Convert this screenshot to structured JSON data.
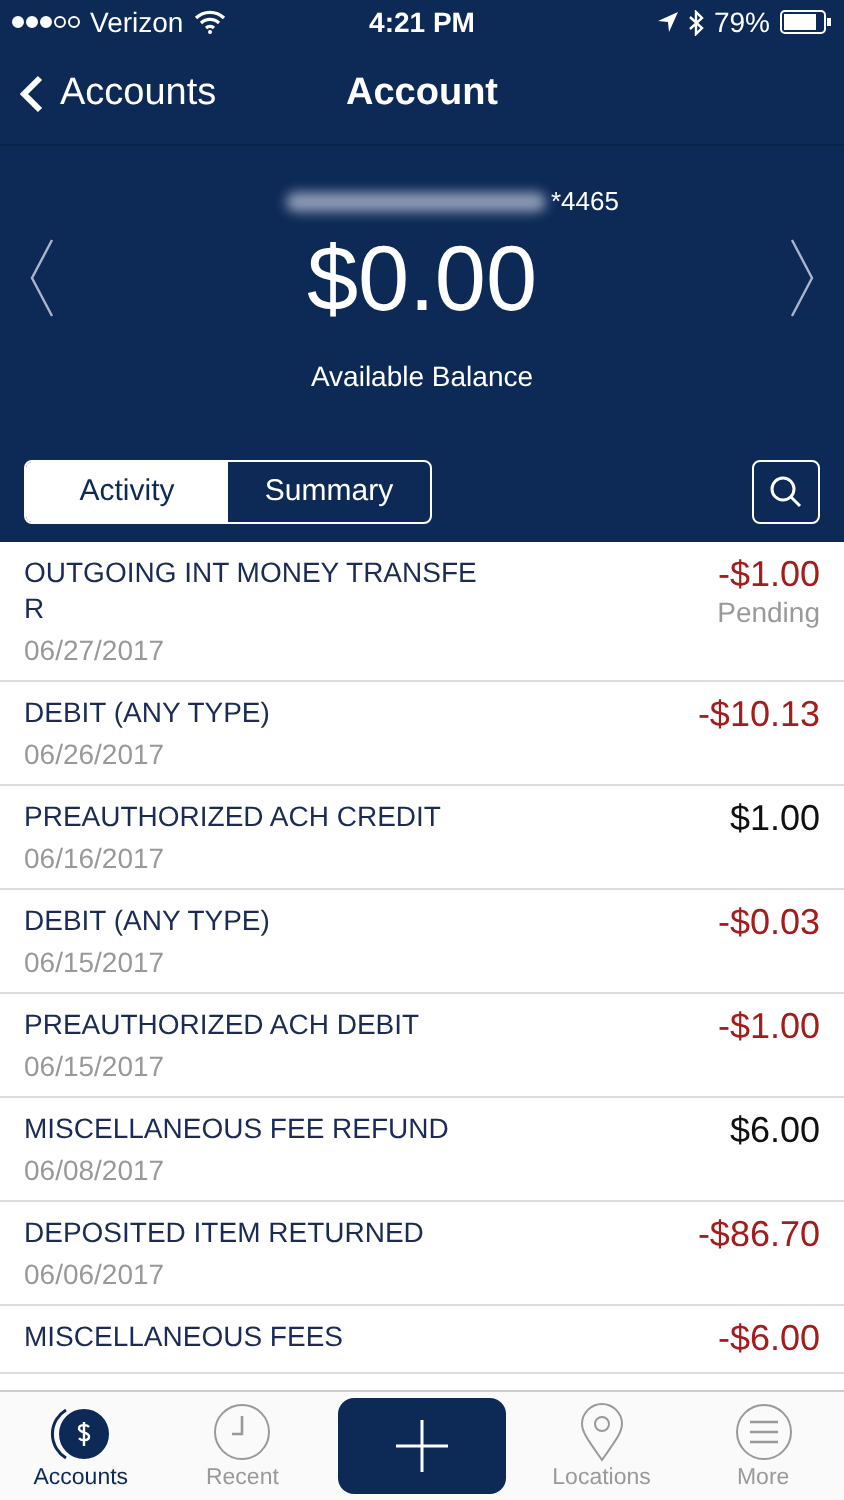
{
  "status_bar": {
    "carrier": "Verizon",
    "time": "4:21 PM",
    "battery": "79%"
  },
  "nav": {
    "back": "Accounts",
    "title": "Account"
  },
  "balance": {
    "account_suffix": "*4465",
    "amount": "$0.00",
    "label": "Available Balance"
  },
  "tabs": [
    {
      "label": "Activity",
      "selected": true
    },
    {
      "label": "Summary",
      "selected": false
    }
  ],
  "transactions": [
    {
      "title_lines": [
        "OUTGOING INT MONEY TRANSFE",
        "R"
      ],
      "date": "06/27/2017",
      "amount": "-$1.00",
      "kind": "debit",
      "status": "Pending"
    },
    {
      "title_lines": [
        "DEBIT (ANY TYPE)"
      ],
      "date": "06/26/2017",
      "amount": "-$10.13",
      "kind": "debit"
    },
    {
      "title_lines": [
        "PREAUTHORIZED ACH CREDIT"
      ],
      "date": "06/16/2017",
      "amount": "$1.00",
      "kind": "credit"
    },
    {
      "title_lines": [
        "DEBIT (ANY TYPE)"
      ],
      "date": "06/15/2017",
      "amount": "-$0.03",
      "kind": "debit"
    },
    {
      "title_lines": [
        "PREAUTHORIZED ACH DEBIT"
      ],
      "date": "06/15/2017",
      "amount": "-$1.00",
      "kind": "debit"
    },
    {
      "title_lines": [
        "MISCELLANEOUS FEE REFUND"
      ],
      "date": "06/08/2017",
      "amount": "$6.00",
      "kind": "credit"
    },
    {
      "title_lines": [
        "DEPOSITED ITEM RETURNED"
      ],
      "date": "06/06/2017",
      "amount": "-$86.70",
      "kind": "debit"
    },
    {
      "title_lines": [
        "MISCELLANEOUS FEES"
      ],
      "amount": "-$6.00",
      "kind": "debit"
    }
  ],
  "tab_bar": [
    {
      "label": "Accounts",
      "kind": "accounts",
      "selected": true
    },
    {
      "label": "Recent",
      "kind": "recent",
      "selected": false
    },
    {
      "kind": "add"
    },
    {
      "label": "Locations",
      "kind": "locations",
      "selected": false
    },
    {
      "label": "More",
      "kind": "more",
      "selected": false
    }
  ]
}
